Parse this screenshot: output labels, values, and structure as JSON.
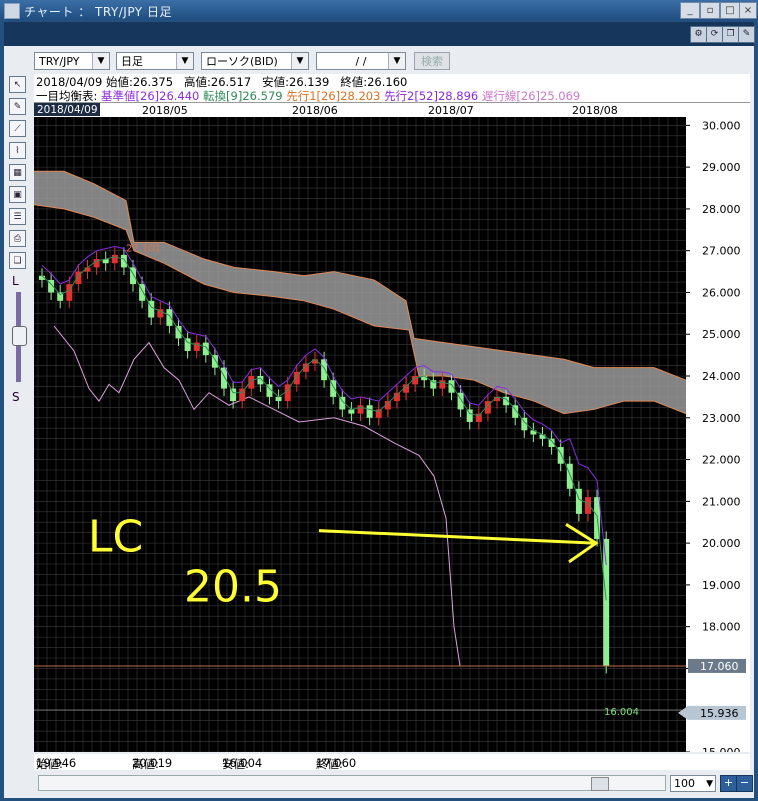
{
  "window": {
    "title": "チャート ： TRY/JPY 日足"
  },
  "toolbar": {
    "pair": "TRY/JPY",
    "period": "日足",
    "chart_type": "ローソク(BID)",
    "date_value": "/ /",
    "search_label": "検索"
  },
  "info": {
    "date": "2018/04/09",
    "open_label": "始値:",
    "open": "26.375",
    "high_label": "高値:",
    "high": "26.517",
    "low_label": "安値:",
    "low": "26.139",
    "close_label": "終値:",
    "close": "26.160",
    "ichimoku_label": "一目均衡表:",
    "kijun": "基準値[26]26.440",
    "tenkan": "転換[9]26.579",
    "senkou1": "先行1[26]28.203",
    "senkou2": "先行2[52]28.896",
    "chikou": "遅行線[26]25.069"
  },
  "bottom": {
    "open_label": "始値:",
    "open": "19.946",
    "high_label": "高値:",
    "high": "20.019",
    "low_label": "安値:",
    "low": "16.004",
    "close_label": "終値:",
    "close": "17.060"
  },
  "sidebar": {
    "slider_top": "L",
    "slider_bottom": "S"
  },
  "zoom": {
    "value": "100"
  },
  "colors": {
    "background": "#000000",
    "grid": "#3a3a3a",
    "up_candle": "#e03030",
    "down_candle": "#90ee90",
    "kijun": "#8a2be2",
    "tenkan": "#2e8b57",
    "cloud": "#d0a090",
    "chikou": "#dda0dd",
    "annotation": "#ffff33"
  },
  "chart_data": {
    "type": "candlestick",
    "x_labels": [
      "2018/04/09",
      "2018/05",
      "2018/06",
      "2018/07",
      "2018/08"
    ],
    "y_ticks": [
      "30.000",
      "29.000",
      "28.000",
      "27.000",
      "26.000",
      "25.000",
      "24.000",
      "23.000",
      "22.000",
      "21.000",
      "20.000",
      "19.000",
      "18.000",
      "17.000",
      "16.000",
      "15.000"
    ],
    "ylim": [
      15.0,
      30.2
    ],
    "annotations": {
      "high_marker": "27.101",
      "low_marker": "16.004",
      "price_line": "17.060",
      "current_price": "15.936",
      "handwritten_line1": "LC",
      "handwritten_line2": "20.5"
    },
    "close_series": [
      26.3,
      26.0,
      25.8,
      26.2,
      26.5,
      26.6,
      26.8,
      26.7,
      26.9,
      26.6,
      26.2,
      25.8,
      25.4,
      25.6,
      25.2,
      24.9,
      24.6,
      24.8,
      24.5,
      24.2,
      23.7,
      23.4,
      23.7,
      24.0,
      23.8,
      23.5,
      23.4,
      23.8,
      24.1,
      24.3,
      24.4,
      23.9,
      23.5,
      23.2,
      23.1,
      23.3,
      23.0,
      23.2,
      23.4,
      23.6,
      23.8,
      24.0,
      23.9,
      23.7,
      23.9,
      23.6,
      23.2,
      22.9,
      23.1,
      23.4,
      23.5,
      23.3,
      23.0,
      22.7,
      22.6,
      22.5,
      22.3,
      21.9,
      21.3,
      20.7,
      21.1,
      20.1,
      17.06
    ]
  }
}
